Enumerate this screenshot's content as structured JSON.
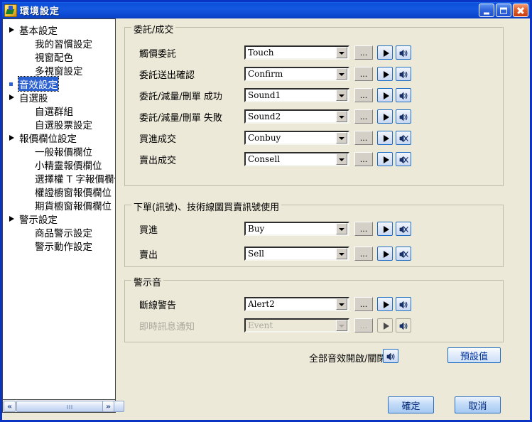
{
  "window": {
    "title": "環境設定",
    "icon": "app-icon",
    "buttons": {
      "minimize": "minimize-button",
      "maximize": "maximize-button",
      "close": "close-button"
    },
    "accent_title_blue": "#0A4ED8",
    "background": "#ECE9D8"
  },
  "sidebar": {
    "items": [
      {
        "label": "基本設定",
        "level": 0,
        "marker": "arrow",
        "selected": false
      },
      {
        "label": "我的習慣設定",
        "level": 1,
        "marker": "none",
        "selected": false
      },
      {
        "label": "視窗配色",
        "level": 1,
        "marker": "none",
        "selected": false
      },
      {
        "label": "多視窗設定",
        "level": 1,
        "marker": "none",
        "selected": false
      },
      {
        "label": "音效設定",
        "level": 1,
        "marker": "bullet",
        "selected": true
      },
      {
        "label": "自選股",
        "level": 0,
        "marker": "arrow",
        "selected": false
      },
      {
        "label": "自選群組",
        "level": 1,
        "marker": "none",
        "selected": false
      },
      {
        "label": "自選股票設定",
        "level": 1,
        "marker": "none",
        "selected": false
      },
      {
        "label": "報價欄位設定",
        "level": 0,
        "marker": "arrow",
        "selected": false
      },
      {
        "label": "一般報價欄位",
        "level": 1,
        "marker": "none",
        "selected": false
      },
      {
        "label": "小精靈報價欄位",
        "level": 1,
        "marker": "none",
        "selected": false
      },
      {
        "label": "選擇權 T 字報價欄位",
        "level": 1,
        "marker": "none",
        "selected": false
      },
      {
        "label": "權證櫥窗報價欄位",
        "level": 1,
        "marker": "none",
        "selected": false
      },
      {
        "label": "期貨櫥窗報價欄位",
        "level": 1,
        "marker": "none",
        "selected": false
      },
      {
        "label": "警示設定",
        "level": 0,
        "marker": "arrow",
        "selected": false
      },
      {
        "label": "商品警示設定",
        "level": 1,
        "marker": "none",
        "selected": false
      },
      {
        "label": "警示動作設定",
        "level": 1,
        "marker": "none",
        "selected": false
      }
    ],
    "scrollbar": {
      "left_arrow": "«",
      "right_arrow": "»"
    }
  },
  "groups": [
    {
      "title": "委託/成交",
      "rows": [
        {
          "label": "觸價委託",
          "value": "Touch",
          "browse": "...",
          "play": "play-icon",
          "sound": "speaker-icon",
          "muted": false,
          "disabled": false
        },
        {
          "label": "委託送出確認",
          "value": "Confirm",
          "browse": "...",
          "play": "play-icon",
          "sound": "speaker-icon",
          "muted": false,
          "disabled": false
        },
        {
          "label": "委託/減量/刪單 成功",
          "value": "Sound1",
          "browse": "...",
          "play": "play-icon",
          "sound": "speaker-icon",
          "muted": false,
          "disabled": false
        },
        {
          "label": "委託/減量/刪單 失敗",
          "value": "Sound2",
          "browse": "...",
          "play": "play-icon",
          "sound": "speaker-icon",
          "muted": false,
          "disabled": false
        },
        {
          "label": "買進成交",
          "value": "Conbuy",
          "browse": "...",
          "play": "play-icon",
          "sound": "speaker-muted-icon",
          "muted": true,
          "disabled": false
        },
        {
          "label": "賣出成交",
          "value": "Consell",
          "browse": "...",
          "play": "play-icon",
          "sound": "speaker-muted-icon",
          "muted": true,
          "disabled": false
        }
      ]
    },
    {
      "title": "下單(訊號)、技術線圖買賣訊號使用",
      "rows": [
        {
          "label": "買進",
          "value": "Buy",
          "browse": "...",
          "play": "play-icon",
          "sound": "speaker-muted-icon",
          "muted": true,
          "disabled": false
        },
        {
          "label": "賣出",
          "value": "Sell",
          "browse": "...",
          "play": "play-icon",
          "sound": "speaker-muted-icon",
          "muted": true,
          "disabled": false
        }
      ]
    },
    {
      "title": "警示音",
      "rows": [
        {
          "label": "斷線警告",
          "value": "Alert2",
          "browse": "...",
          "play": "play-icon",
          "sound": "speaker-icon",
          "muted": false,
          "disabled": false
        },
        {
          "label": "即時訊息通知",
          "value": "Event",
          "browse": "...",
          "play": "play-icon",
          "sound": "speaker-icon",
          "muted": false,
          "disabled": true
        }
      ]
    }
  ],
  "footer": {
    "all_sound_label": "全部音效開啟/關閉",
    "all_sound_icon": "speaker-icon",
    "default_button": "預設值",
    "ok_button": "確定",
    "cancel_button": "取消",
    "button_text_color": "#00267A"
  }
}
